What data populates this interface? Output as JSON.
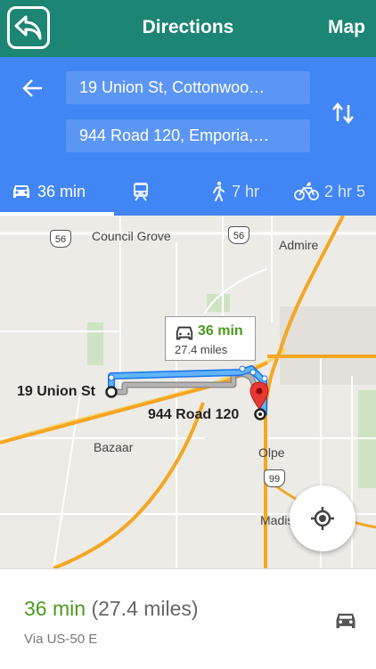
{
  "header": {
    "title": "Directions",
    "map_link": "Map",
    "back_icon": "back-arrow-icon"
  },
  "directions": {
    "from": "19 Union St, Cottonwoo…",
    "to": "944 Road 120, Emporia,…",
    "modes": [
      {
        "name": "drive",
        "label": "36 min",
        "icon": "car-icon",
        "active": true
      },
      {
        "name": "transit",
        "label": "",
        "icon": "train-icon",
        "active": false
      },
      {
        "name": "walk",
        "label": "7 hr",
        "icon": "walk-icon",
        "active": false
      },
      {
        "name": "bike",
        "label": "2 hr 5",
        "icon": "bike-icon",
        "active": false
      }
    ]
  },
  "map": {
    "labels": {
      "council_grove": "Council Grove",
      "admire": "Admire",
      "bazaar": "Bazaar",
      "olpe": "Olpe",
      "madis": "Madis"
    },
    "shields": {
      "us56_left": "56",
      "us56_right": "56",
      "route99": "99"
    },
    "origin_label": "19 Union St",
    "destination_label": "944 Road 120",
    "callout": {
      "duration": "36 min",
      "distance": "27.4 miles"
    }
  },
  "summary": {
    "duration": "36 min",
    "distance": "(27.4 miles)",
    "via": "Via US-50 E"
  },
  "colors": {
    "topbar": "#1c8573",
    "panel": "#4285f4",
    "accent_green": "#4a9a1e",
    "route_blue": "#4aa3f5"
  }
}
